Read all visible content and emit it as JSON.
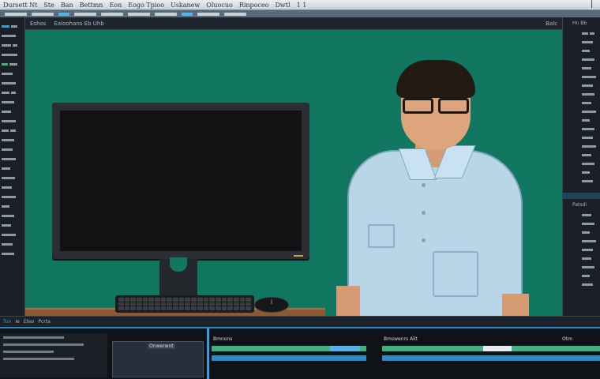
{
  "titlebar": {
    "menu": [
      "Dursett Nt",
      "Ste",
      "Ban",
      "Bettmn",
      "Eon",
      "Eogo Tpioo",
      "Uskanew",
      "Oluocuo",
      "Rinpoceo",
      "Dwtl",
      "1 1"
    ]
  },
  "viewport": {
    "header_label": "Eshos",
    "header_meta": "Ealoohans Eb  Uhb",
    "zoom_label": "Balc"
  },
  "status": {
    "items": [
      "Tun",
      "Ie",
      "Eteo",
      "Pcrta"
    ]
  },
  "timeline": {
    "clip_label": "Onwerwnt",
    "track_label_1": "Bmnons",
    "track_label_2": "Bmswenrs Alit",
    "track_label_3": "Otm"
  },
  "right_panel": {
    "header": "Hn Bb",
    "panel_label": "Patsdi"
  },
  "colors": {
    "viewport_bg": "#127760",
    "accent": "#3a9be0",
    "shirt": "#b8d6e8",
    "track_green": "#3fb27f"
  }
}
